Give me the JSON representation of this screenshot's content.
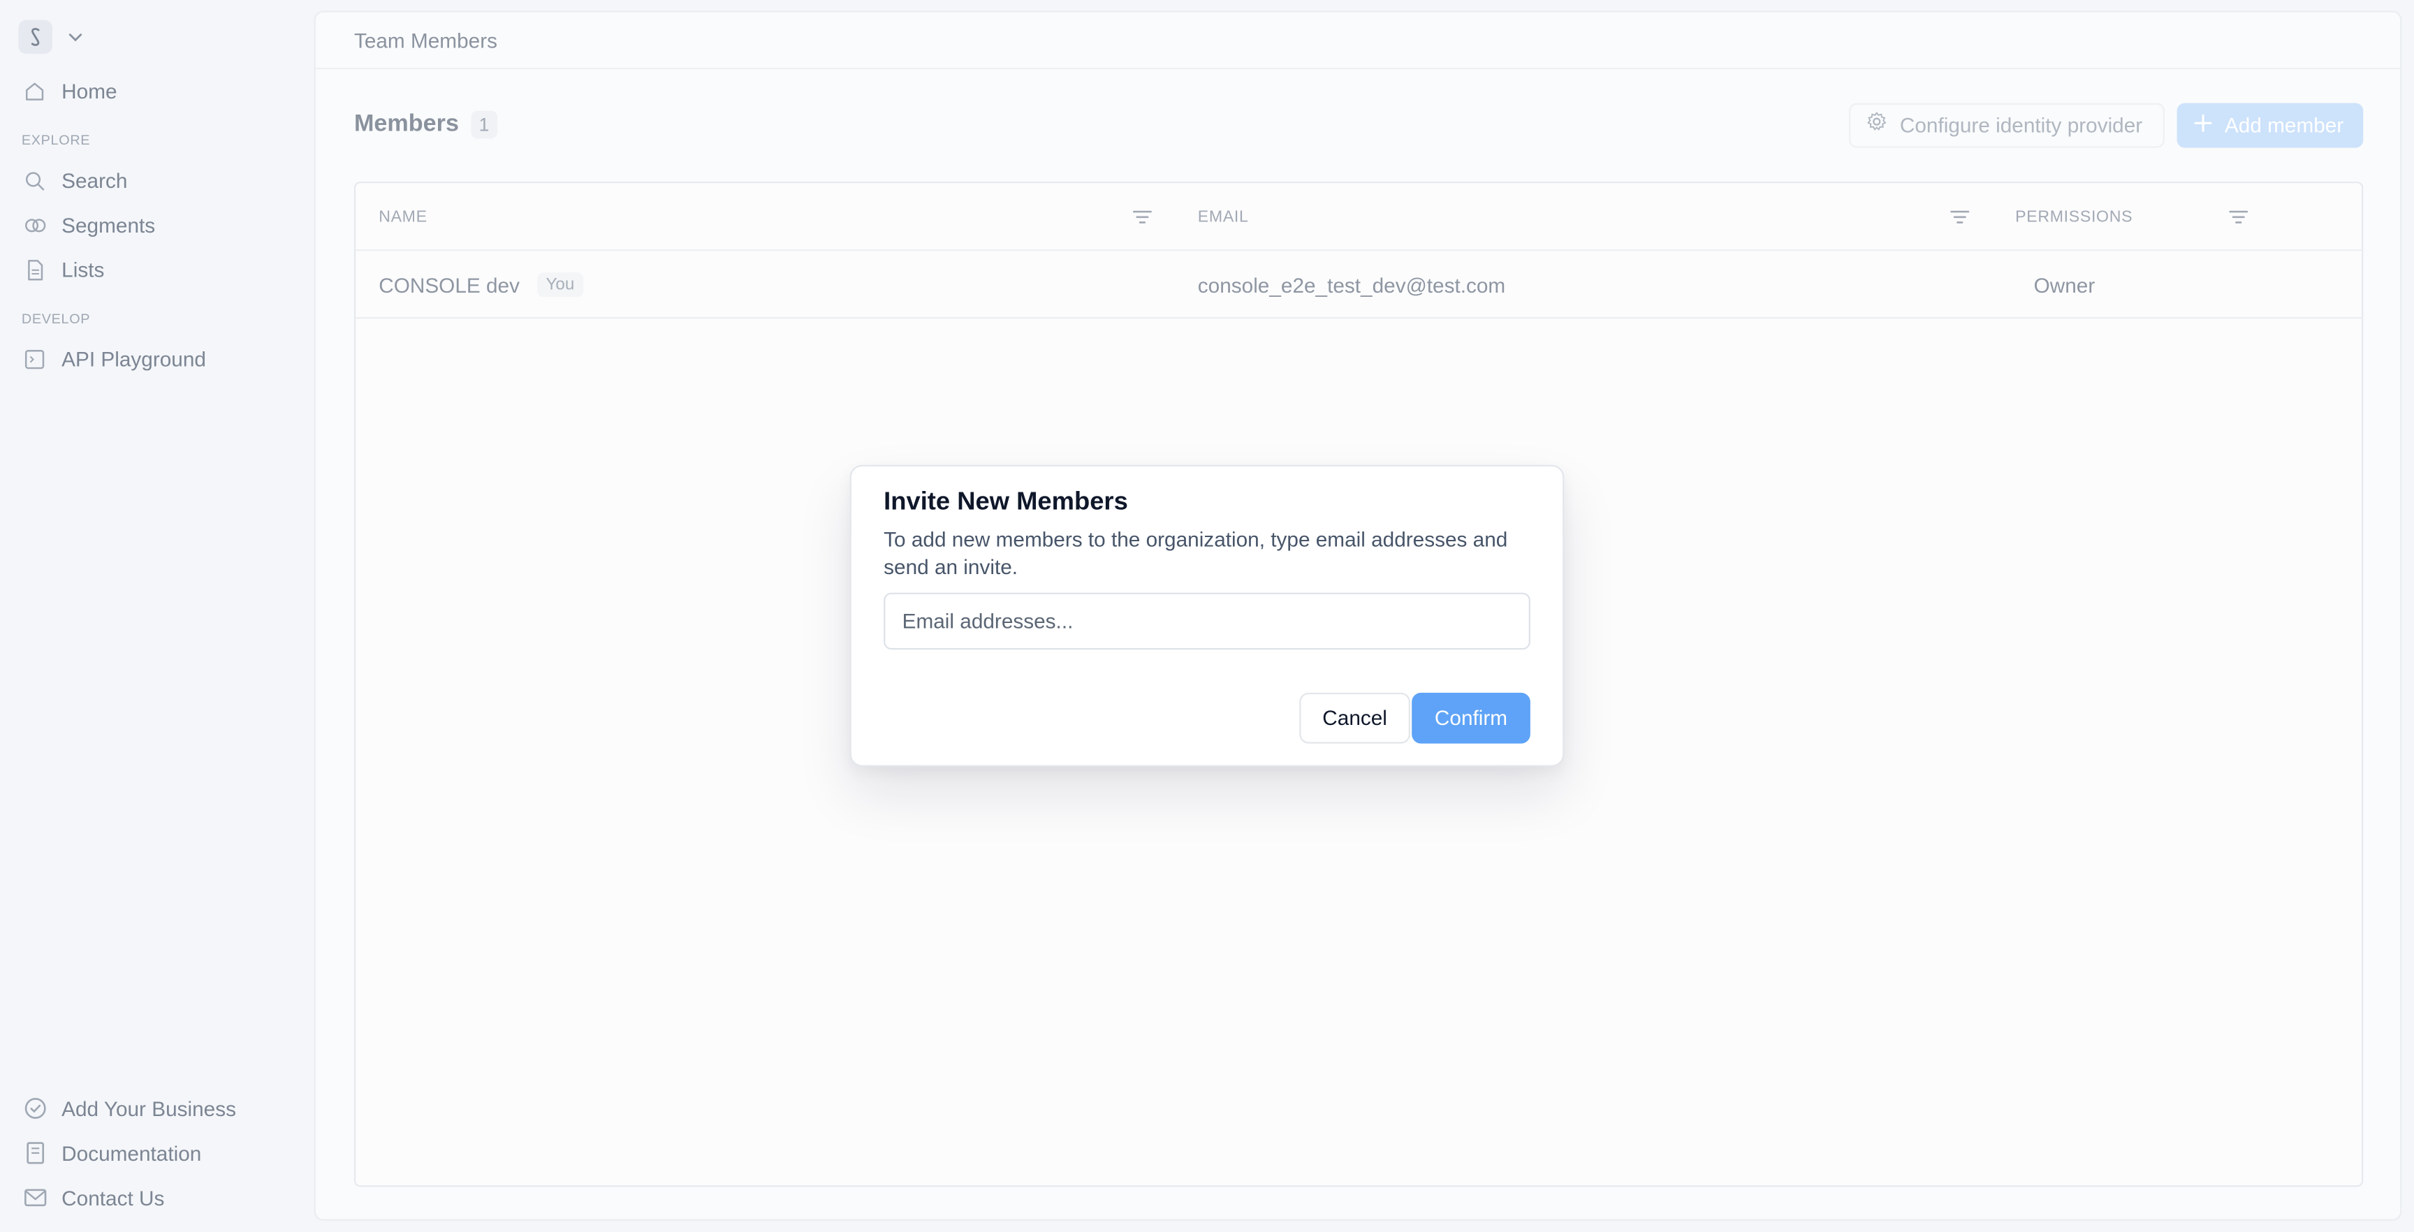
{
  "sidebar": {
    "logo_icon": "s-logo-icon",
    "dropdown_icon": "chevron-down-icon",
    "home_label": "Home",
    "explore_label": "EXPLORE",
    "explore_items": [
      {
        "label": "Search",
        "icon": "search-icon"
      },
      {
        "label": "Segments",
        "icon": "segments-icon"
      },
      {
        "label": "Lists",
        "icon": "document-icon"
      }
    ],
    "develop_label": "DEVELOP",
    "develop_items": [
      {
        "label": "API Playground",
        "icon": "terminal-icon"
      }
    ],
    "footer_items": [
      {
        "label": "Add Your Business",
        "icon": "badge-check-icon"
      },
      {
        "label": "Documentation",
        "icon": "book-icon"
      },
      {
        "label": "Contact Us",
        "icon": "mail-icon"
      }
    ]
  },
  "header": {
    "title": "Team Members"
  },
  "members": {
    "title": "Members",
    "count": "1",
    "configure_label": "Configure identity provider",
    "add_label": "Add member"
  },
  "table": {
    "columns": [
      "NAME",
      "EMAIL",
      "PERMISSIONS"
    ],
    "rows": [
      {
        "name": "CONSOLE dev",
        "badge": "You",
        "email": "console_e2e_test_dev@test.com",
        "permission": "Owner"
      }
    ]
  },
  "modal": {
    "title": "Invite New Members",
    "description": "To add new members to the organization, type email addresses and send an invite.",
    "input_placeholder": "Email addresses...",
    "input_value": "",
    "cancel_label": "Cancel",
    "confirm_label": "Confirm"
  },
  "colors": {
    "accent": "#5ea3f7",
    "accent_disabled": "#cde2fb",
    "background": "#f4f6f9"
  }
}
